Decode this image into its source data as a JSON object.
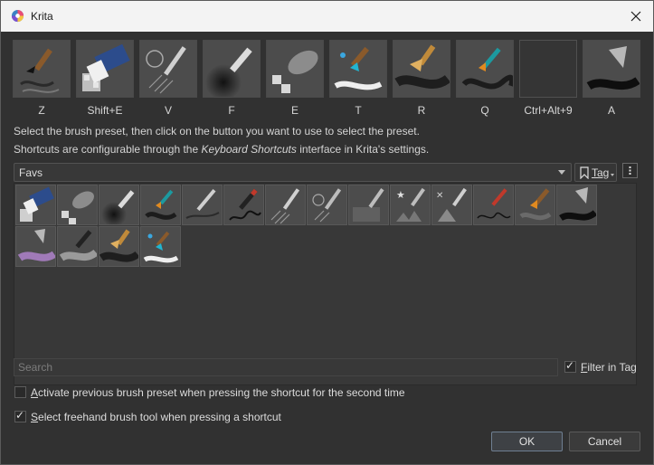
{
  "window": {
    "title": "Krita",
    "close_icon": "close-icon",
    "logo_icon": "krita-logo-icon"
  },
  "shortcut_slots": [
    {
      "label": "Z",
      "preset": "brush-ink-stroke"
    },
    {
      "label": "Shift+E",
      "preset": "eraser-block"
    },
    {
      "label": "V",
      "preset": "pencil-hatching"
    },
    {
      "label": "F",
      "preset": "airbrush-soft"
    },
    {
      "label": "E",
      "preset": "eraser-soft"
    },
    {
      "label": "T",
      "preset": "watercolor-blue"
    },
    {
      "label": "R",
      "preset": "bristle-brush-gray"
    },
    {
      "label": "Q",
      "preset": "orange-brush-swirl"
    },
    {
      "label": "Ctrl+Alt+9",
      "preset": ""
    },
    {
      "label": "A",
      "preset": "palette-knife-black"
    }
  ],
  "info": {
    "line1": "Select the brush preset, then click on the button you want to use to select the preset.",
    "line2_prefix": "Shortcuts are configurable through the ",
    "line2_emphasis": "Keyboard Shortcuts",
    "line2_suffix": " interface in Krita's settings."
  },
  "tag_filter": {
    "selected": "Favs",
    "tag_button_label": "Tag",
    "tag_icon": "bookmark-icon",
    "menu_icon": "more-options-icon"
  },
  "presets": [
    "eraser-block",
    "eraser-soft",
    "airbrush-soft",
    "teal-brush-swirl",
    "pencil-line",
    "ink-pen-scribble",
    "pencil-hatching",
    "pen-hatching",
    "charcoal-texture",
    "star-stamp",
    "texture-stamp",
    "red-brush-swirl",
    "orange-brush-swirl",
    "palette-knife-black",
    "palette-knife-purple",
    "blender-gray",
    "bristle-brush-gray",
    "watercolor-blue"
  ],
  "search": {
    "placeholder": "Search",
    "value": ""
  },
  "filter_in_tag": {
    "label": "Filter in Tag",
    "checked": true
  },
  "options": {
    "activate_previous": {
      "label": "Activate previous brush preset when pressing the shortcut for the second time",
      "checked": false
    },
    "select_freehand": {
      "label": "Select freehand brush tool when pressing a shortcut",
      "checked": true
    }
  },
  "buttons": {
    "ok_label": "OK",
    "cancel_label": "Cancel"
  }
}
